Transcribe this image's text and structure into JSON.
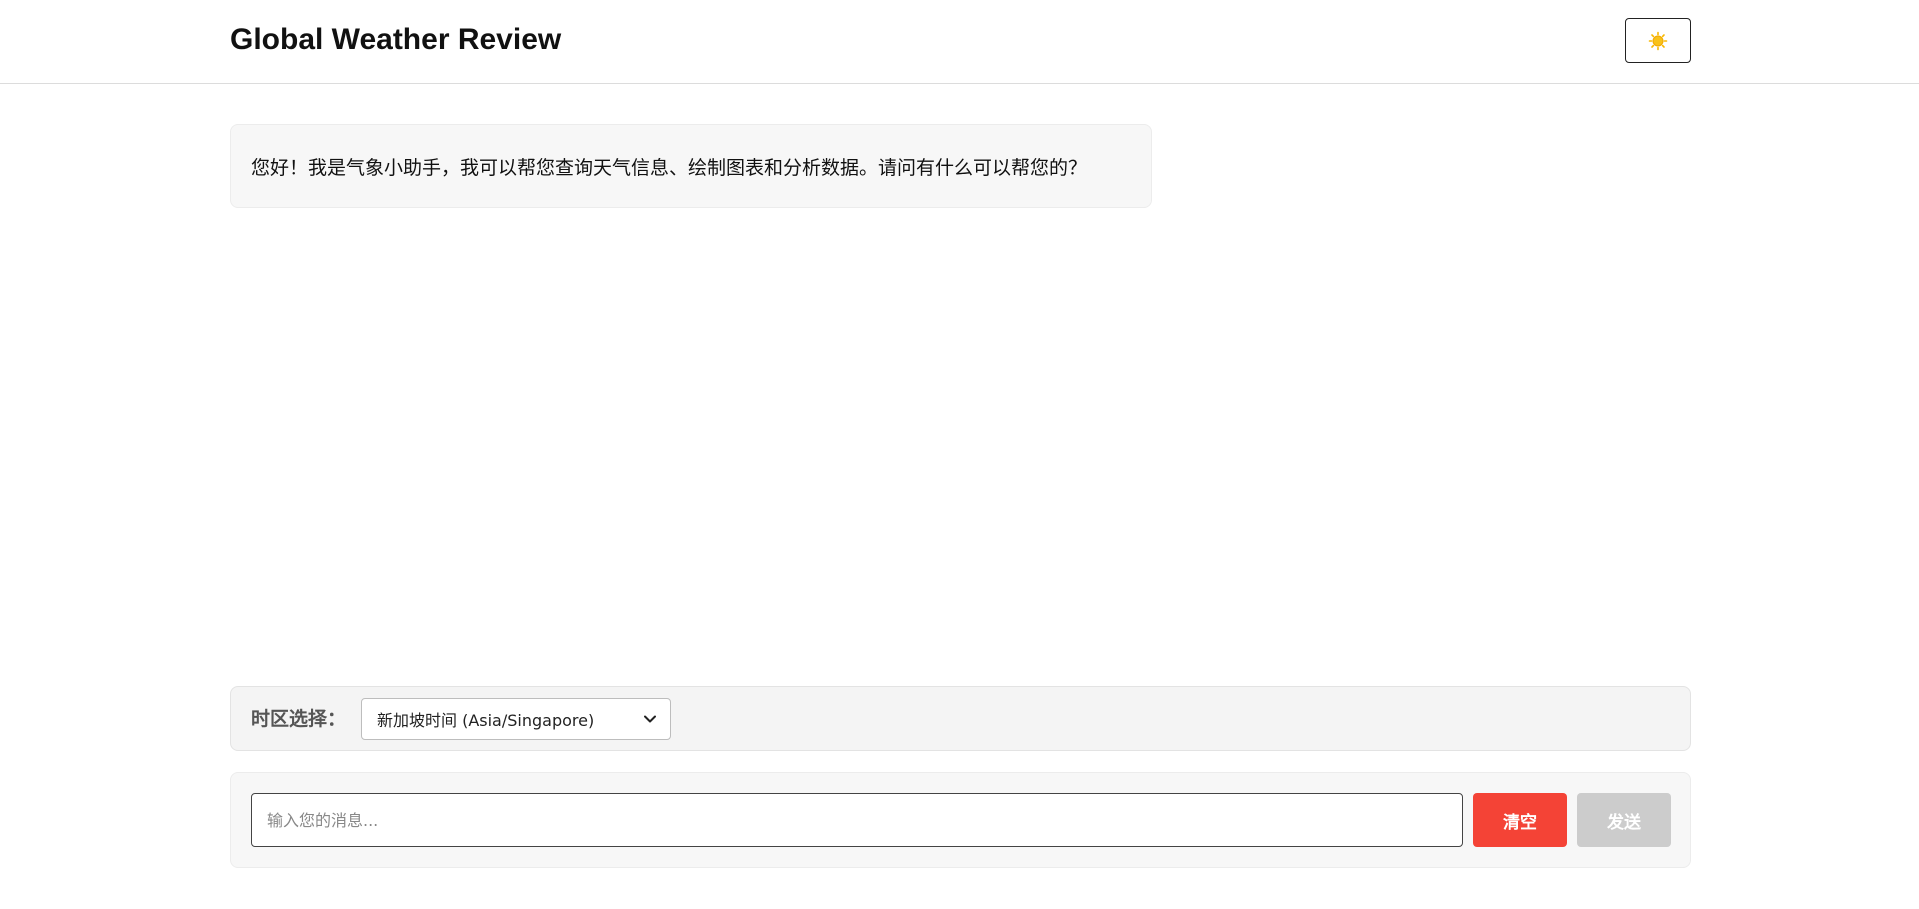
{
  "header": {
    "title": "Global Weather Review",
    "theme_toggle_icon": "sun-icon"
  },
  "chat": {
    "messages": [
      {
        "role": "assistant",
        "text": "您好！我是气象小助手，我可以帮您查询天气信息、绘制图表和分析数据。请问有什么可以帮您的？"
      }
    ]
  },
  "timezone": {
    "label": "时区选择：",
    "selected": "新加坡时间 (Asia/Singapore)"
  },
  "composer": {
    "placeholder": "输入您的消息...",
    "value": "",
    "clear_label": "清空",
    "send_label": "发送"
  },
  "colors": {
    "clear_button": "#f44336",
    "send_button_disabled": "#cccccc",
    "sun": "#f9b800"
  }
}
